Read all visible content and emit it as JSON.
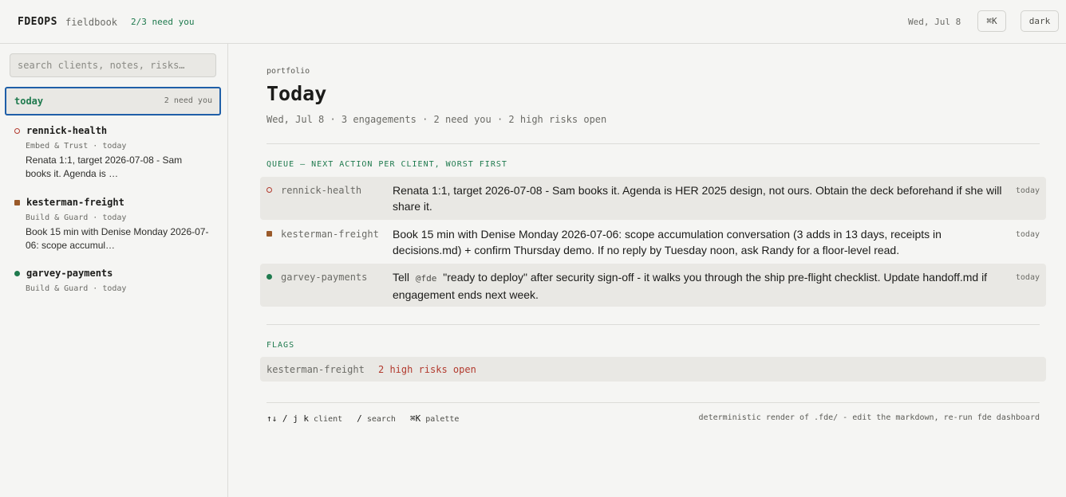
{
  "header": {
    "brand": "FDEOPS",
    "brand_sub": "fieldbook",
    "need_you": "2/3 need you",
    "date": "Wed, Jul 8",
    "palette_button": "⌘K",
    "theme_button": "dark"
  },
  "sidebar": {
    "search_placeholder": "search clients, notes, risks…",
    "today": {
      "label": "today",
      "count": "2 need you"
    },
    "clients": [
      {
        "name": "rennick-health",
        "meta": "Embed & Trust · today",
        "note": "Renata 1:1, target 2026-07-08 - Sam books it. Agenda is …",
        "status_icon": "ring",
        "color": "#b23a2e"
      },
      {
        "name": "kesterman-freight",
        "meta": "Build & Guard · today",
        "note": "Book 15 min with Denise Monday 2026-07-06: scope accumul…",
        "status_icon": "square",
        "color": "#9a5a2a"
      },
      {
        "name": "garvey-payments",
        "meta": "Build & Guard · today",
        "note": "",
        "status_icon": "dot",
        "color": "#1f7a4e"
      }
    ]
  },
  "main": {
    "breadcrumb": "portfolio",
    "title": "Today",
    "subtitle": "Wed, Jul 8 · 3 engagements · 2 need you · 2 high risks open",
    "queue_heading": "QUEUE — NEXT ACTION PER CLIENT, WORST FIRST",
    "queue": [
      {
        "client": "rennick-health",
        "text": "Renata 1:1, target 2026-07-08 - Sam books it. Agenda is HER 2025 design, not ours. Obtain the deck beforehand if she will share it.",
        "when": "today"
      },
      {
        "client": "kesterman-freight",
        "text": "Book 15 min with Denise Monday 2026-07-06: scope accumulation conversation (3 adds in 13 days, receipts in decisions.md) + confirm Thursday demo. If no reply by Tuesday noon, ask Randy for a floor-level read.",
        "when": "today"
      },
      {
        "client": "garvey-payments",
        "text_before": "Tell",
        "code": "@fde",
        "text_after": "\"ready to deploy\" after security sign-off - it walks you through the ship pre-flight checklist. Update handoff.md if engagement ends next week.",
        "when": "today"
      }
    ],
    "flags_heading": "FLAGS",
    "flags": [
      {
        "client": "kesterman-freight",
        "value": "2 high risks open"
      }
    ]
  },
  "footer": {
    "nav_keys": "↑↓ / j k",
    "nav_label": "client",
    "search_key": "/",
    "search_label": "search",
    "palette_key": "⌘K",
    "palette_label": "palette",
    "note": "deterministic render of .fde/ - edit the markdown, re-run fde dashboard"
  },
  "colors": {
    "accent_green": "#1f7a4e",
    "risk_red": "#b23a2e",
    "warn_brown": "#9a5a2a",
    "focus_blue": "#1f5fa8"
  }
}
